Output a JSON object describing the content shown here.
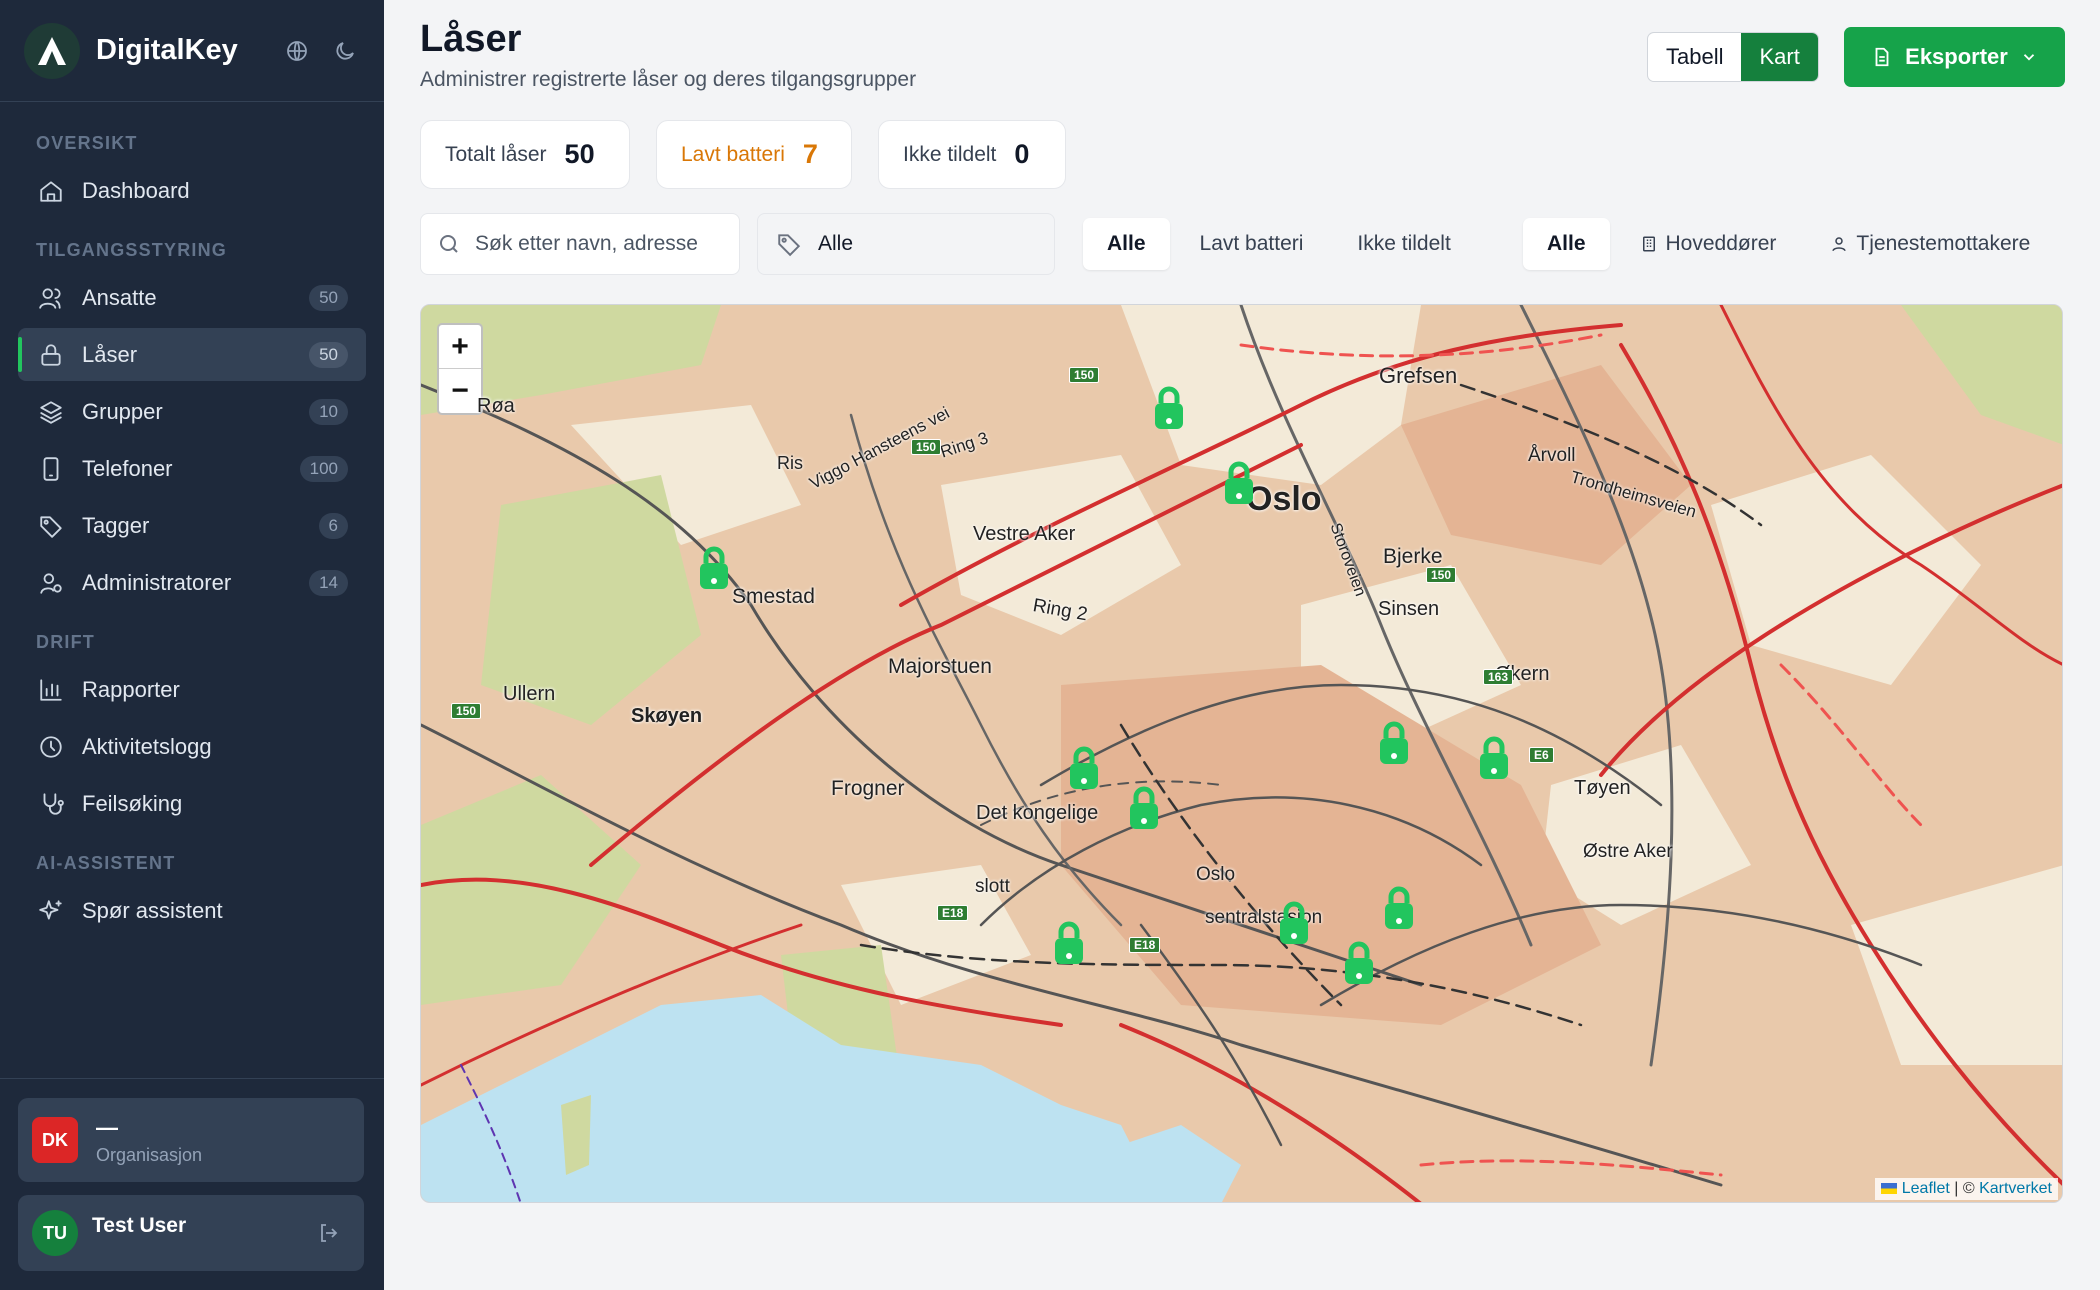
{
  "app": {
    "name": "DigitalKey",
    "logo_letter": "A"
  },
  "sidebar": {
    "sections": [
      {
        "title": "OVERSIKT",
        "items": [
          {
            "label": "Dashboard",
            "icon": "home-icon",
            "count": ""
          }
        ]
      },
      {
        "title": "TILGANGSSTYRING",
        "items": [
          {
            "label": "Ansatte",
            "icon": "users-icon",
            "count": "50"
          },
          {
            "label": "Låser",
            "icon": "lock-icon",
            "count": "50",
            "active": true
          },
          {
            "label": "Grupper",
            "icon": "layers-icon",
            "count": "10"
          },
          {
            "label": "Telefoner",
            "icon": "phone-icon",
            "count": "100"
          },
          {
            "label": "Tagger",
            "icon": "tag-icon",
            "count": "6"
          },
          {
            "label": "Administratorer",
            "icon": "user-cog-icon",
            "count": "14"
          }
        ]
      },
      {
        "title": "DRIFT",
        "items": [
          {
            "label": "Rapporter",
            "icon": "bar-chart-icon",
            "count": ""
          },
          {
            "label": "Aktivitetslogg",
            "icon": "clock-icon",
            "count": ""
          },
          {
            "label": "Feilsøking",
            "icon": "stethoscope-icon",
            "count": ""
          }
        ]
      },
      {
        "title": "AI-ASSISTENT",
        "items": [
          {
            "label": "Spør assistent",
            "icon": "sparkles-icon",
            "count": ""
          }
        ]
      }
    ],
    "org": {
      "badge": "DK",
      "name": "—",
      "label": "Organisasjon",
      "badge_color": "#dc2626"
    },
    "user": {
      "initials": "TU",
      "name": "Test User",
      "avatar_color": "#15803d"
    }
  },
  "page": {
    "title": "Låser",
    "subtitle": "Administrer registrerte låser og deres tilgangsgrupper"
  },
  "view_toggle": {
    "table": "Tabell",
    "map": "Kart",
    "active": "map"
  },
  "export": {
    "label": "Eksporter"
  },
  "stats": [
    {
      "label": "Totalt låser",
      "value": "50"
    },
    {
      "label": "Lavt batteri",
      "value": "7",
      "tone": "warning"
    },
    {
      "label": "Ikke tildelt",
      "value": "0"
    }
  ],
  "filters": {
    "search_placeholder": "Søk etter navn, adresse",
    "tag_select": "Alle",
    "status": [
      "Alle",
      "Lavt batteri",
      "Ikke tildelt"
    ],
    "type": [
      "Alle",
      "Hoveddører",
      "Tjenestemottakere"
    ]
  },
  "map": {
    "zoom_in": "+",
    "zoom_out": "−",
    "attribution": {
      "leaflet": "Leaflet",
      "sep": " | © ",
      "source": "Kartverket"
    },
    "labels": [
      "Grefsen",
      "Røa",
      "Ris",
      "Viggo Hansteens vei",
      "Ring 3",
      "Oslo",
      "Årvoll",
      "Trondheimsveien",
      "Vestre Aker",
      "Storoveien",
      "Bjerke",
      "Smestad",
      "Ring 2",
      "Sinsen",
      "Majorstuen",
      "Økern",
      "Ullern",
      "Skøyen",
      "Tøyen",
      "Frogner",
      "Det kongelige",
      "slott",
      "Oslo",
      "sentralstasjon",
      "Østre Aker"
    ],
    "road_labels": [
      "150",
      "150",
      "150",
      "150",
      "163",
      "E6",
      "E18",
      "E18"
    ],
    "marker_color": "#22c55e",
    "lock_markers": 11
  },
  "colors": {
    "accent": "#16a34a",
    "sidebar": "#1e293b",
    "warning": "#d97706"
  }
}
